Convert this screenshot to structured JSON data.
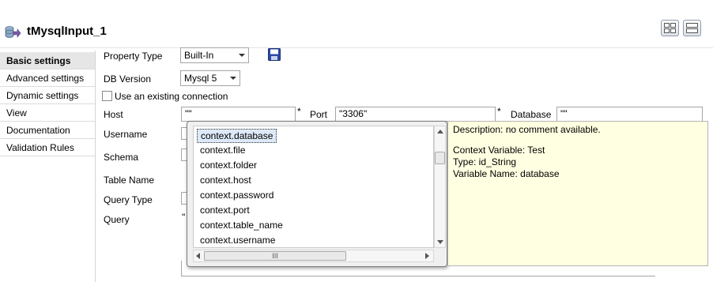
{
  "component": {
    "title": "tMysqlInput_1",
    "icon": "mysql-input-icon"
  },
  "header": {
    "layout_buttons": [
      "grid-layout-icon",
      "rows-layout-icon"
    ]
  },
  "sidebar": {
    "items": [
      {
        "label": "Basic settings",
        "active": true
      },
      {
        "label": "Advanced settings"
      },
      {
        "label": "Dynamic settings"
      },
      {
        "label": "View"
      },
      {
        "label": "Documentation"
      },
      {
        "label": "Validation Rules"
      }
    ]
  },
  "form": {
    "property_type": {
      "label": "Property Type",
      "value": "Built-In"
    },
    "db_version": {
      "label": "DB Version",
      "value": "Mysql 5"
    },
    "existing_connection": {
      "label": "Use an existing connection",
      "checked": false
    },
    "host": {
      "label": "Host",
      "value": "\"\"",
      "required": "*"
    },
    "port": {
      "label": "Port",
      "value": "\"3306\"",
      "required": "*"
    },
    "database": {
      "label": "Database",
      "value": "\"\""
    },
    "username": {
      "label": "Username"
    },
    "schema": {
      "label": "Schema"
    },
    "table_name": {
      "label": "Table Name"
    },
    "query_type": {
      "label": "Query Type"
    },
    "query": {
      "label": "Query",
      "value_prefix": "\""
    }
  },
  "popup": {
    "items": [
      "context.database",
      "context.file",
      "context.folder",
      "context.host",
      "context.password",
      "context.port",
      "context.table_name",
      "context.username"
    ],
    "selected_index": 0,
    "hscroll_grip": "III"
  },
  "description": {
    "line1": "Description: no comment available.",
    "line2": "Context Variable: Test",
    "line3": "Type: id_String",
    "line4": "Variable Name: database"
  },
  "colors": {
    "tooltip_bg": "#ffffe1",
    "selection": "#dde9f8",
    "active_tab": "#e6e6e6"
  }
}
